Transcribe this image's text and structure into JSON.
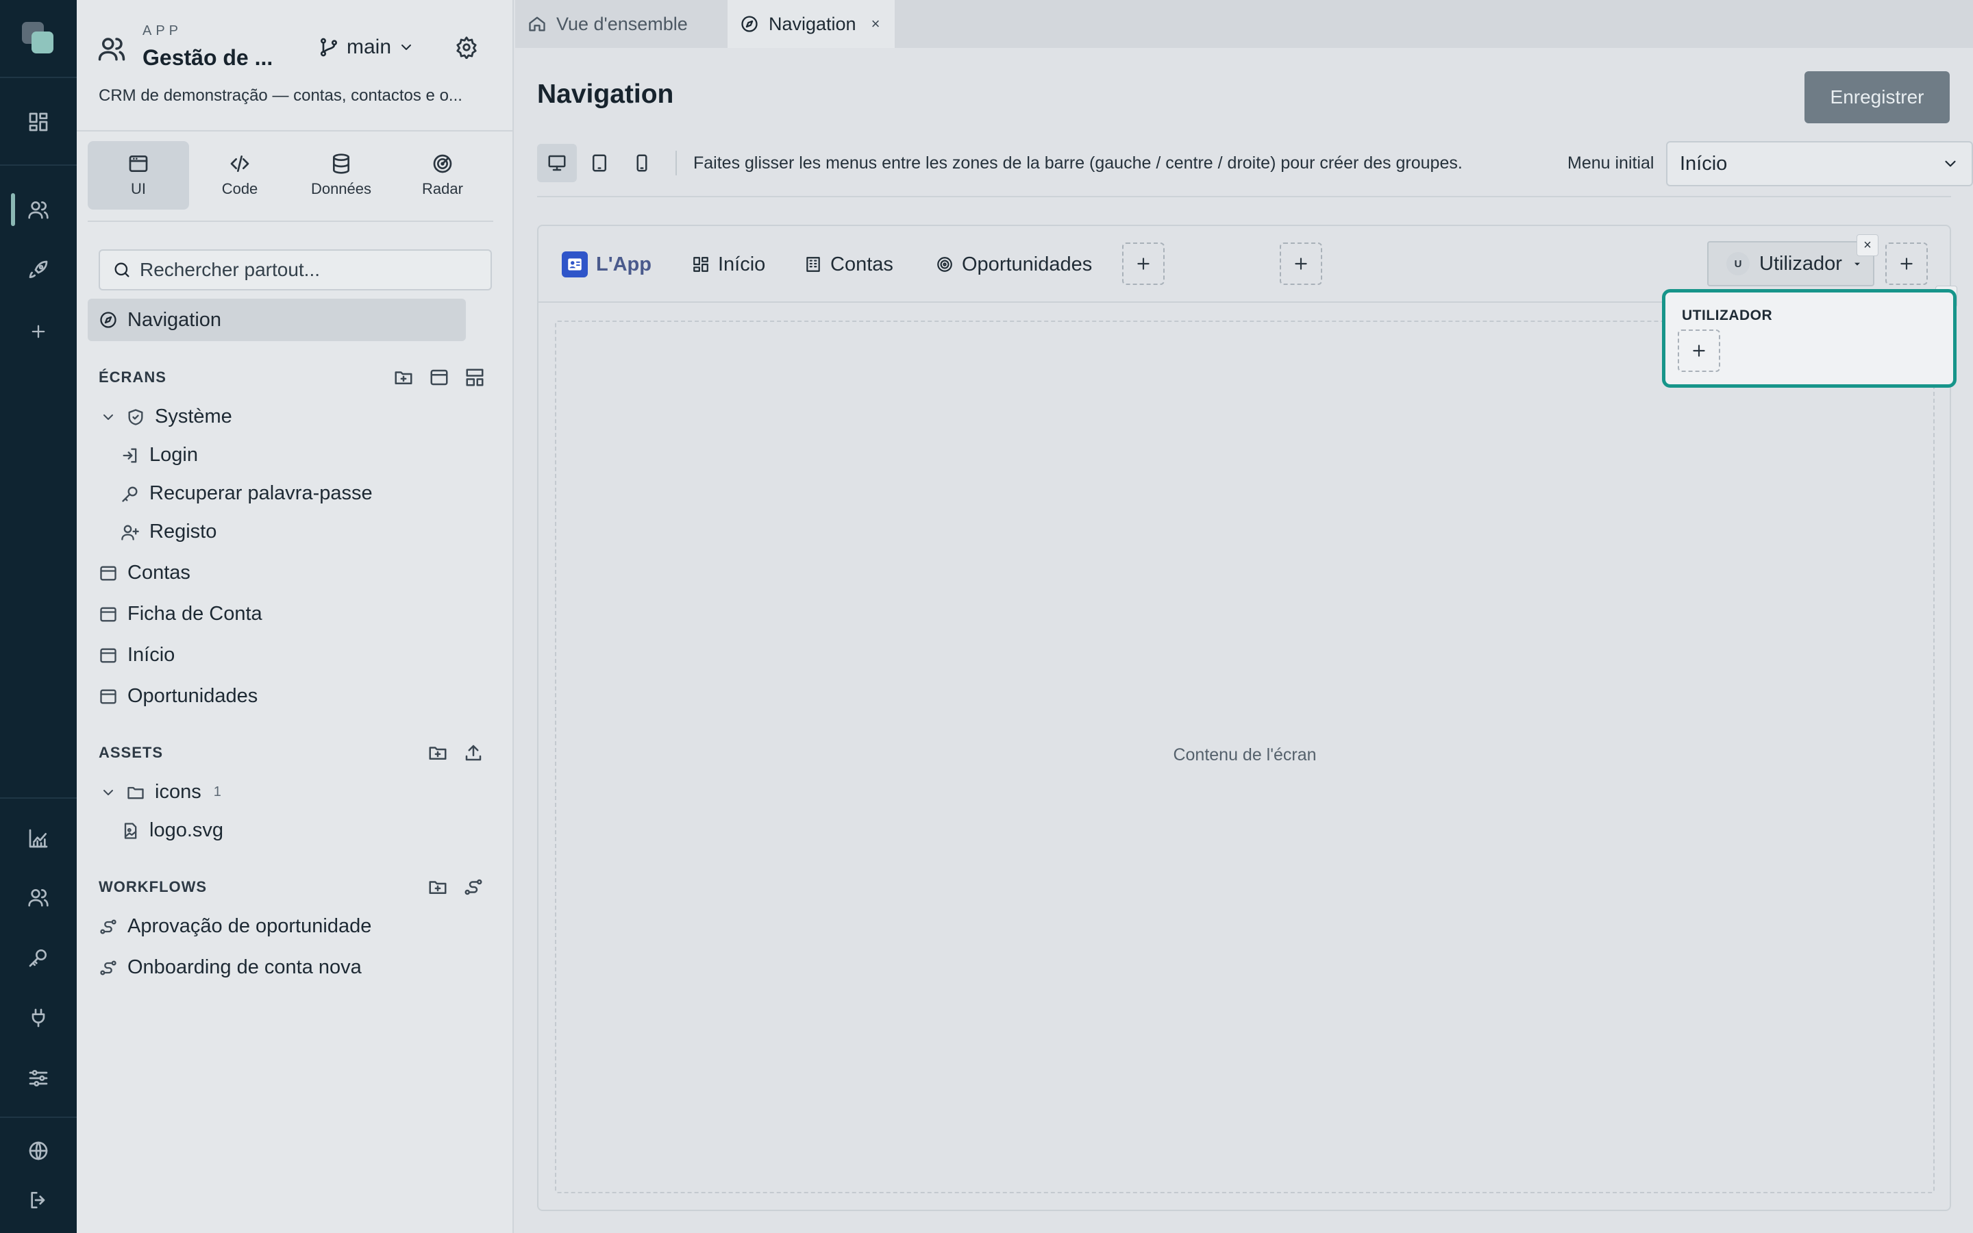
{
  "app": {
    "kicker": "APP",
    "name": "Gestão de ...",
    "branch": "main",
    "description": "CRM de demonstração — contas, contactos e o..."
  },
  "modes": [
    {
      "label": "UI",
      "icon": "window-icon"
    },
    {
      "label": "Code",
      "icon": "code-icon"
    },
    {
      "label": "Données",
      "icon": "database-icon"
    },
    {
      "label": "Radar",
      "icon": "radar-icon"
    }
  ],
  "search": {
    "placeholder": "Rechercher partout..."
  },
  "nav_item": "Navigation",
  "screens": {
    "heading": "ÉCRANS",
    "group": "Système",
    "system_children": [
      "Login",
      "Recuperar palavra-passe",
      "Registo"
    ],
    "items": [
      "Contas",
      "Ficha de Conta",
      "Início",
      "Oportunidades"
    ]
  },
  "assets": {
    "heading": "ASSETS",
    "folder": "icons",
    "folder_count": "1",
    "files": [
      "logo.svg"
    ]
  },
  "workflows": {
    "heading": "WORKFLOWS",
    "items": [
      "Aprovação de oportunidade",
      "Onboarding de conta nova"
    ]
  },
  "tabs": [
    {
      "label": "Vue d'ensemble",
      "active": false
    },
    {
      "label": "Navigation",
      "active": true,
      "close": "×"
    }
  ],
  "page": {
    "title": "Navigation",
    "save_label": "Enregistrer",
    "hint": "Faites glisser les menus entre les zones de la barre (gauche / centre / droite) pour créer des groupes.",
    "menu_initial_label": "Menu initial",
    "menu_initial_value": "Início"
  },
  "navbar": {
    "brand": "L'App",
    "items": [
      "Início",
      "Contas",
      "Oportunidades"
    ],
    "user_menu": "Utilizador",
    "user_avatar": "U",
    "close_glyph": "×"
  },
  "content_label": "Contenu de l'écran",
  "dropdown": {
    "title": "UTILIZADOR"
  },
  "colors": {
    "rail": "#0f2431",
    "accent": "#17958a",
    "brand": "#2f55c9",
    "save_button": "#6f7c86"
  }
}
